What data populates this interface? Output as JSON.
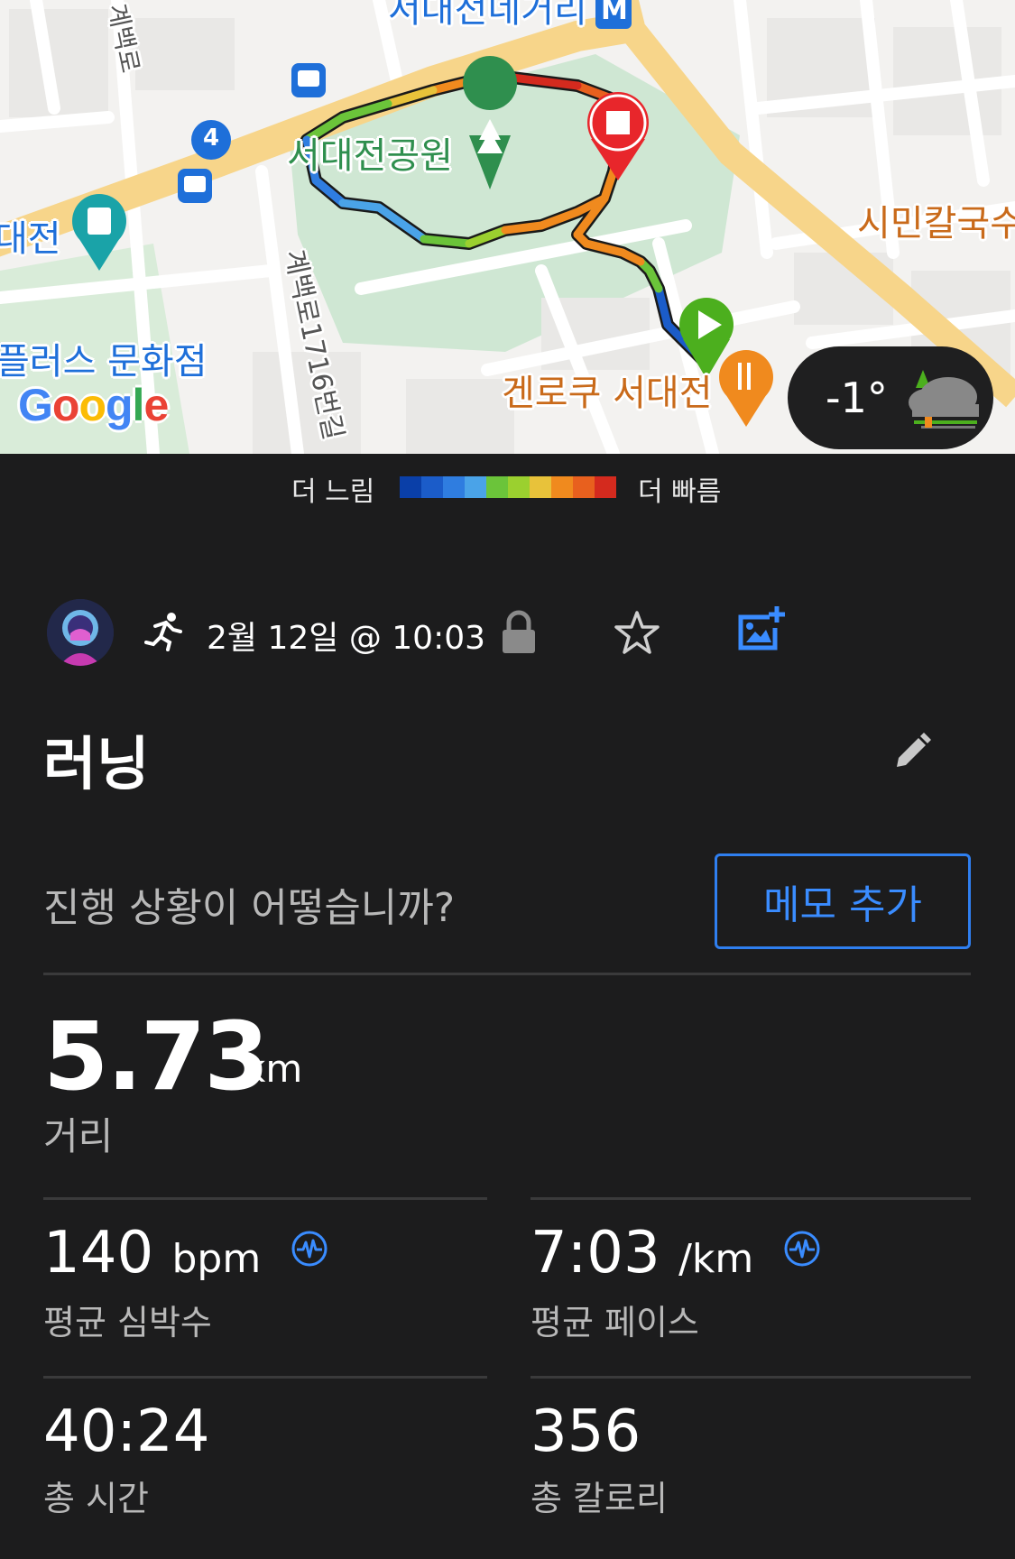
{
  "map": {
    "labels": {
      "park": "서대전공원",
      "station": "서대전네거리",
      "daejeon": "대전",
      "culture": "플러스 문화점",
      "restaurant": "겐로쿠 서대전",
      "noodle": "시민칼국수",
      "road1": "계백로1716번길",
      "road2": "계백로",
      "bus_route": "4",
      "metro_icon": "M"
    },
    "google": "Google",
    "weather": {
      "temperature": "-1°",
      "icon": "cloud-fog-icon"
    }
  },
  "legend": {
    "slow": "더 느림",
    "fast": "더 빠름",
    "colors": [
      "#0a3fa8",
      "#1b5cc9",
      "#2f7de0",
      "#4aa3e8",
      "#6bc43a",
      "#9bd02f",
      "#e8c23a",
      "#f08a1e",
      "#e8601e",
      "#d42a1e"
    ]
  },
  "activity": {
    "type_icon": "running-icon",
    "date": "2월 12일 @ 10:03",
    "title": "러닝"
  },
  "memo": {
    "prompt": "진행 상황이 어떻습니까?",
    "button": "메모 추가"
  },
  "stats": {
    "distance": {
      "value": "5.73",
      "unit": "km",
      "label": "거리"
    },
    "heart_rate": {
      "value": "140",
      "unit": "bpm",
      "label": "평균 심박수"
    },
    "pace": {
      "value": "7:03",
      "unit": "/km",
      "label": "평균 페이스"
    },
    "time": {
      "value": "40:24",
      "label": "총 시간"
    },
    "calories": {
      "value": "356",
      "label": "총 칼로리"
    }
  }
}
